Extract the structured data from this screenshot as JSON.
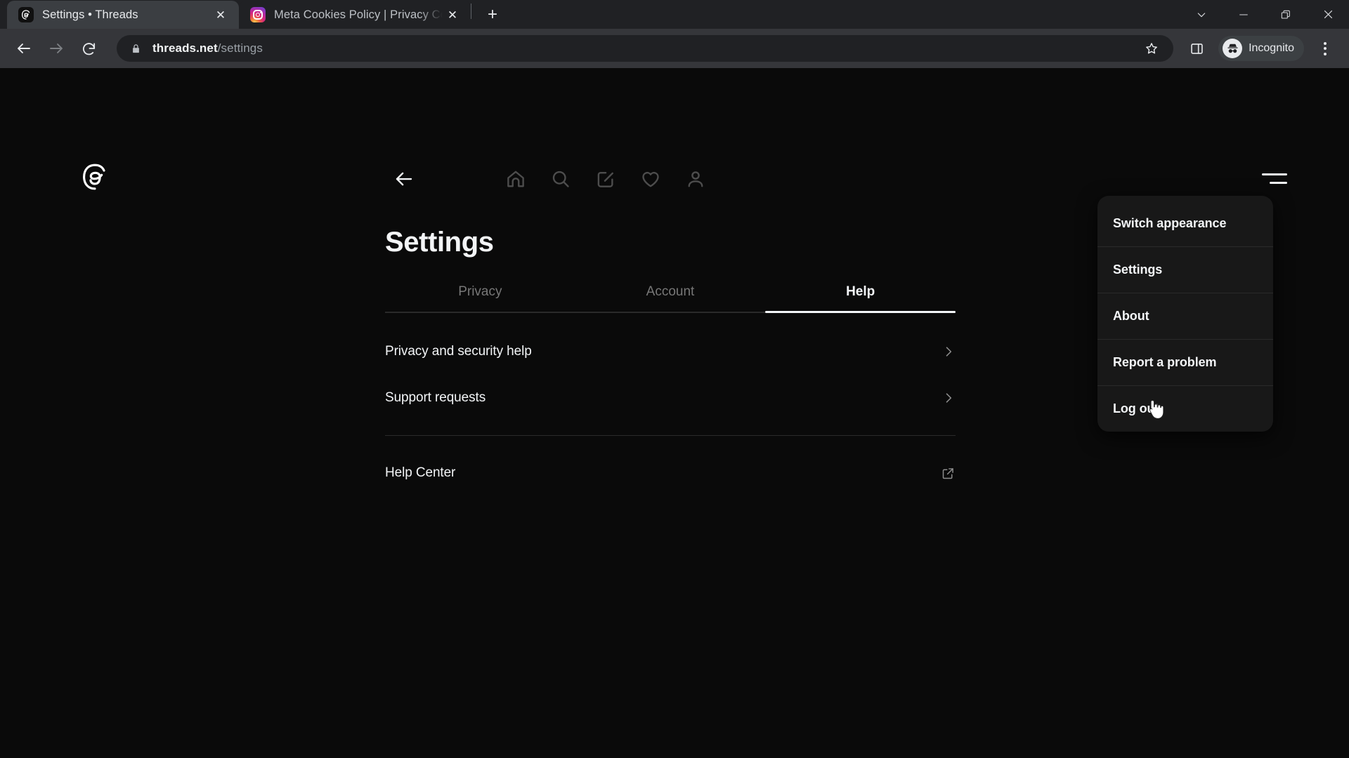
{
  "browser": {
    "tabs": [
      {
        "title": "Settings • Threads",
        "favicon": "threads-icon",
        "active": true,
        "close_label": "✕"
      },
      {
        "title": "Meta Cookies Policy | Privacy Ce",
        "favicon": "instagram-icon",
        "active": false,
        "close_label": "✕"
      }
    ],
    "new_tab_label": "+",
    "window_controls": [
      "tab-search-chevron-icon",
      "minimize-icon",
      "restore-icon",
      "close-icon"
    ],
    "toolbar": {
      "back_icon": "arrow-left-icon",
      "forward_icon": "arrow-right-icon",
      "reload_icon": "reload-icon",
      "lock_icon": "lock-icon",
      "url_host": "threads.net",
      "url_path": "/settings",
      "url_full": "threads.net/settings",
      "star_icon": "star-icon",
      "side_panel_icon": "side-panel-icon",
      "profile_label": "Incognito",
      "profile_icon": "incognito-icon",
      "menu_icon": "three-dots-icon"
    }
  },
  "app": {
    "logo": "threads-logo",
    "nav_icons": [
      "back-arrow-icon",
      "home-icon",
      "search-icon",
      "compose-icon",
      "activity-heart-icon",
      "profile-icon"
    ],
    "menu_button": "hamburger-menu-icon",
    "title": "Settings",
    "tabs": [
      {
        "label": "Privacy",
        "active": false
      },
      {
        "label": "Account",
        "active": false
      },
      {
        "label": "Help",
        "active": true
      }
    ],
    "rows": [
      {
        "label": "Privacy and security help",
        "trailing": "chevron-right-icon"
      },
      {
        "label": "Support requests",
        "trailing": "chevron-right-icon"
      }
    ],
    "external_rows": [
      {
        "label": "Help Center",
        "trailing": "external-link-icon"
      }
    ]
  },
  "dropdown": {
    "items": [
      {
        "label": "Switch appearance"
      },
      {
        "label": "Settings"
      },
      {
        "label": "About"
      },
      {
        "label": "Report a problem"
      },
      {
        "label": "Log out"
      }
    ]
  },
  "colors": {
    "page_bg": "#0a0a0a",
    "menu_bg": "#181818",
    "text_primary": "#f3f5f7",
    "text_muted": "#777777",
    "divider": "#2a2a2a",
    "chrome_bg": "#202124",
    "toolbar_bg": "#35363a"
  }
}
